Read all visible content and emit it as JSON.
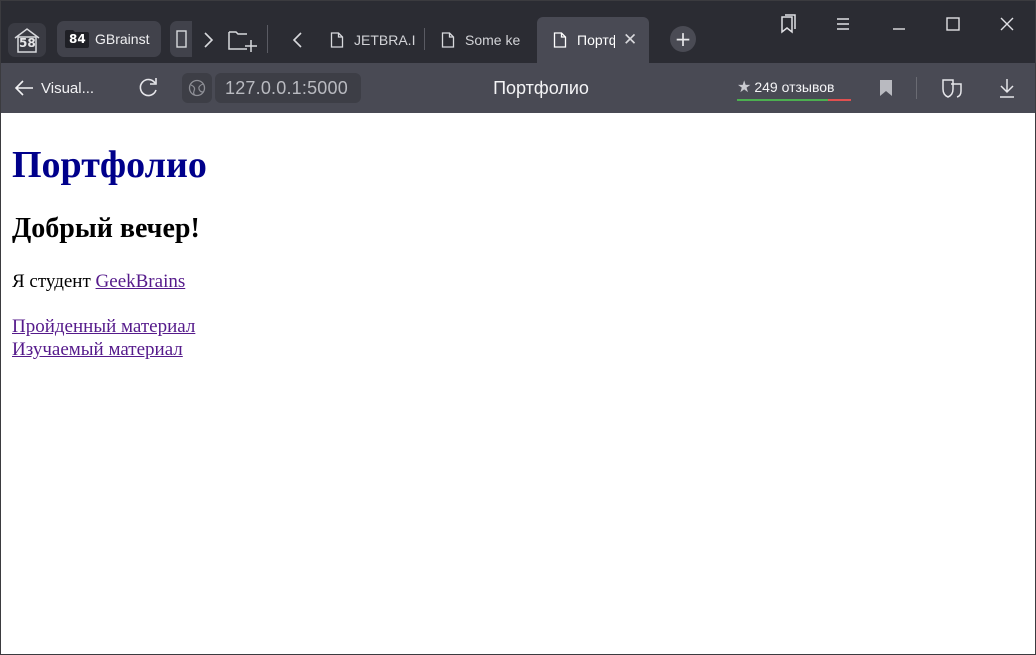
{
  "browser": {
    "home_badge": "58",
    "group_tab": {
      "count": "84",
      "label": "GBrainst"
    },
    "tabs": [
      {
        "label": "JETBRA.I",
        "active": false
      },
      {
        "label": "Some ke",
        "active": false
      },
      {
        "label": "Портф",
        "active": true
      }
    ],
    "nav": {
      "back_label": "Visual...",
      "url": "127.0.0.1:5000",
      "title": "Портфолио",
      "reviews": "249 отзывов"
    },
    "icons": {
      "home": "home-icon",
      "folder": "folder-icon",
      "forward": "chevron-right-icon",
      "new_folder": "new-folder-icon",
      "back_tabs": "chevron-left-icon",
      "document": "document-icon",
      "close": "close-icon",
      "new_tab": "plus-icon",
      "collections": "collections-icon",
      "menu": "menu-icon",
      "minimize": "minimize-icon",
      "maximize": "maximize-icon",
      "window_close": "window-close-icon",
      "back_arrow": "arrow-left-icon",
      "reload": "reload-icon",
      "site": "globe-icon",
      "star": "star-icon",
      "bookmark": "bookmark-icon",
      "protect": "protect-icon",
      "download": "download-icon"
    },
    "colors": {
      "tab_strip": "#2b2c33",
      "toolbar": "#494a54",
      "rating_good": "#4caf50",
      "rating_bad": "#e05050"
    }
  },
  "page": {
    "heading": "Портфолио",
    "greeting": "Добрый вечер!",
    "intro_text": "Я студент ",
    "intro_link": "GeekBrains",
    "links": [
      "Пройденный материал",
      "Изучаемый материал"
    ],
    "colors": {
      "heading": "#00008b",
      "link": "#551a8b"
    }
  }
}
